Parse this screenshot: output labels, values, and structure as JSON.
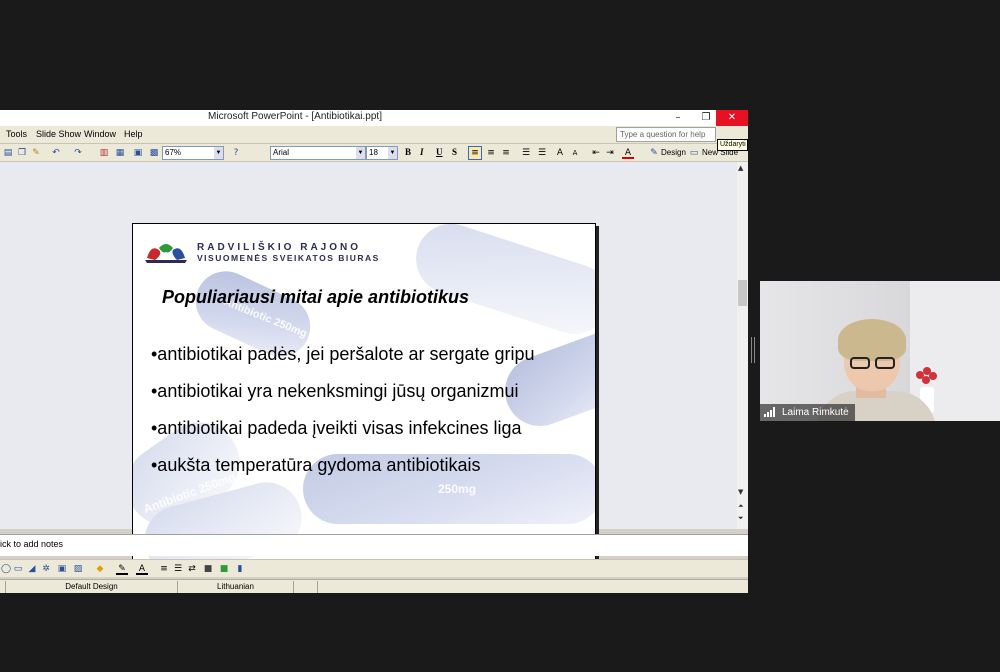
{
  "window": {
    "title": "Microsoft PowerPoint - [Antibiotikai.ppt]",
    "min_glyph": "–",
    "max_glyph": "❐",
    "close_glyph": "✕",
    "tooltip": "Uždaryti"
  },
  "menu": {
    "tools": "Tools",
    "slide_show": "Slide Show",
    "window": "Window",
    "help": "Help",
    "help_placeholder": "Type a question for help"
  },
  "toolbar": {
    "zoom": "67%",
    "font": "Arial",
    "font_size": "18",
    "bold": "B",
    "italic": "I",
    "underline": "U",
    "shadow": "S",
    "design": "Design",
    "new_slide": "New Slide"
  },
  "slide": {
    "logo_line1": "RADVILIŠKIO RAJONO",
    "logo_line2": "VISUOMENĖS SVEIKATOS BIURAS",
    "title": "Populiariausi mitai apie antibiotikus",
    "bullets": [
      "•antibiotikai padės, jei peršalote ar sergate gripu",
      "•antibiotikai yra nekenksmingi jūsų organizmui",
      "•antibiotikai padeda įveikti visas infekcines liga",
      "•aukšta temperatūra gydoma antibiotikais"
    ],
    "pill_texts": [
      "Antibiotic 250mg",
      "Antibiotic",
      "250mg",
      "Antibiotic 250mg"
    ]
  },
  "notes": {
    "placeholder": "ick to add notes"
  },
  "status": {
    "design": "Default Design",
    "language": "Lithuanian"
  },
  "participant": {
    "name": "Laima Rimkutė"
  },
  "colors": {
    "close": "#e81123",
    "title_text": "#2b2b55",
    "selected_button": "#ffe8a6"
  }
}
